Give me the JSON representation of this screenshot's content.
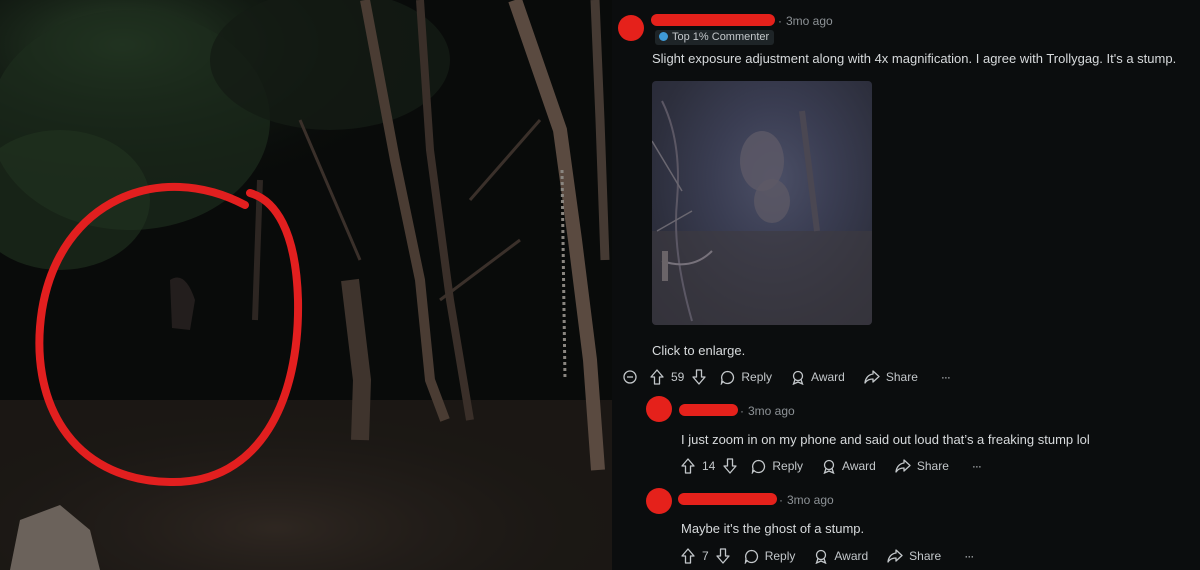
{
  "comments": [
    {
      "time": "3mo ago",
      "flair": "Top 1% Commenter",
      "text": "Slight exposure adjustment along with 4x magnification. I agree with Trollygag. It's a stump.",
      "image_caption": "Click to enlarge.",
      "votes": "59",
      "reply_label": "Reply",
      "award_label": "Award",
      "share_label": "Share",
      "more_label": "···"
    },
    {
      "time": "3mo ago",
      "text": "I just zoom in on my phone and said out loud that’s a freaking stump lol",
      "votes": "14",
      "reply_label": "Reply",
      "award_label": "Award",
      "share_label": "Share",
      "more_label": "···"
    },
    {
      "time": "3mo ago",
      "text": "Maybe it's the ghost of a stump.",
      "votes": "7",
      "reply_label": "Reply",
      "award_label": "Award",
      "share_label": "Share",
      "more_label": "···"
    }
  ],
  "colors": {
    "redaction": "#e5211b",
    "background": "#0b0d0e",
    "text": "#d7dadc",
    "meta": "#8d9296",
    "flair_icon": "#3f9ad7"
  },
  "icons": [
    "upvote-icon",
    "downvote-icon",
    "reply-bubble-icon",
    "award-icon",
    "share-arrow-icon",
    "collapse-icon",
    "more-icon"
  ]
}
